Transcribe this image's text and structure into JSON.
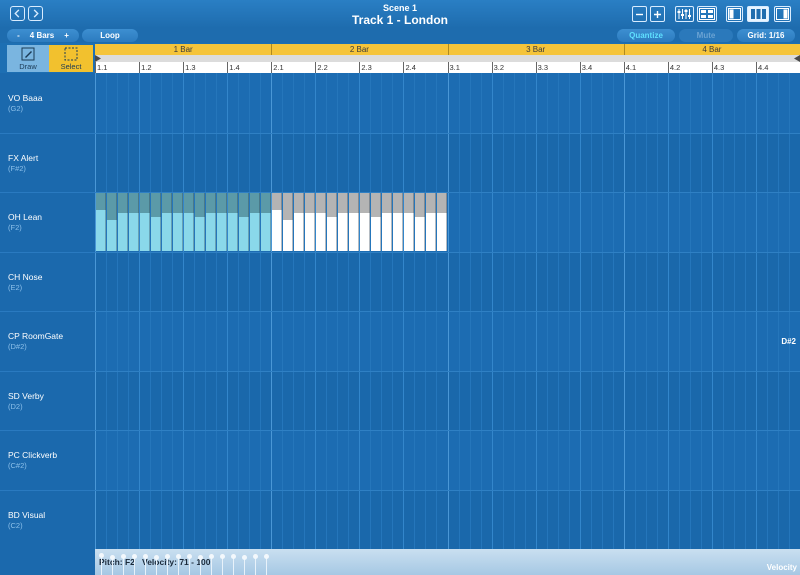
{
  "header": {
    "scene_title": "Scene 1",
    "track_title": "Track 1 - London"
  },
  "toolbar": {
    "bars_minus": "-",
    "bars_label": "4 Bars",
    "bars_plus": "+",
    "loop_label": "Loop",
    "quantize_label": "Quantize",
    "mute_label": "Mute",
    "grid_label": "Grid: 1/16"
  },
  "tools": {
    "draw_label": "Draw",
    "select_label": "Select"
  },
  "timeline": {
    "bars": [
      "1 Bar",
      "2 Bar",
      "3 Bar",
      "4 Bar"
    ],
    "beats": [
      "1.1",
      "1.2",
      "1.3",
      "1.4",
      "2.1",
      "2.2",
      "2.3",
      "2.4",
      "3.1",
      "3.2",
      "3.3",
      "3.4",
      "4.1",
      "4.2",
      "4.3",
      "4.4"
    ]
  },
  "lanes": [
    {
      "name": "VO Baaa",
      "note": "(G2)"
    },
    {
      "name": "FX Alert",
      "note": "(F#2)"
    },
    {
      "name": "OH Lean",
      "note": "(F2)"
    },
    {
      "name": "CH Nose",
      "note": "(E2)"
    },
    {
      "name": "CP RoomGate",
      "note": "(D#2)"
    },
    {
      "name": "SD Verby",
      "note": "(D2)"
    },
    {
      "name": "PC Clickverb",
      "note": "(C#2)"
    },
    {
      "name": "BD Visual",
      "note": "(C2)"
    }
  ],
  "edge_label": "D#2",
  "notes": {
    "lane_index": 2,
    "steps_total": 64,
    "selected_color": "#8ad8ea",
    "selected_top_color": "#5b9aa8",
    "unselected_color": "#ffffff",
    "unselected_top_color": "#b4b4b4",
    "velocities": [
      [
        0,
        88
      ],
      [
        1,
        71
      ],
      [
        2,
        82
      ],
      [
        3,
        82
      ],
      [
        4,
        82
      ],
      [
        5,
        76
      ],
      [
        6,
        82
      ],
      [
        7,
        82
      ],
      [
        8,
        82
      ],
      [
        9,
        76
      ],
      [
        10,
        82
      ],
      [
        11,
        82
      ],
      [
        12,
        82
      ],
      [
        13,
        76
      ],
      [
        14,
        82
      ],
      [
        15,
        82
      ],
      [
        16,
        88
      ],
      [
        17,
        71
      ],
      [
        18,
        82
      ],
      [
        19,
        82
      ],
      [
        20,
        82
      ],
      [
        21,
        76
      ],
      [
        22,
        82
      ],
      [
        23,
        82
      ],
      [
        24,
        82
      ],
      [
        25,
        76
      ],
      [
        26,
        82
      ],
      [
        27,
        82
      ],
      [
        28,
        82
      ],
      [
        29,
        76
      ],
      [
        30,
        82
      ],
      [
        31,
        82
      ]
    ],
    "selected_count": 16
  },
  "velocity_panel": {
    "pitch_label": "Pitch: F2",
    "velocity_label": "Velocity: 71 - 100",
    "corner_label": "Velocity"
  },
  "colors": {
    "accent_yellow": "#f5c43a",
    "grid_blue": "#1b6bb0",
    "quantize_cyan": "#5fe0ff"
  }
}
